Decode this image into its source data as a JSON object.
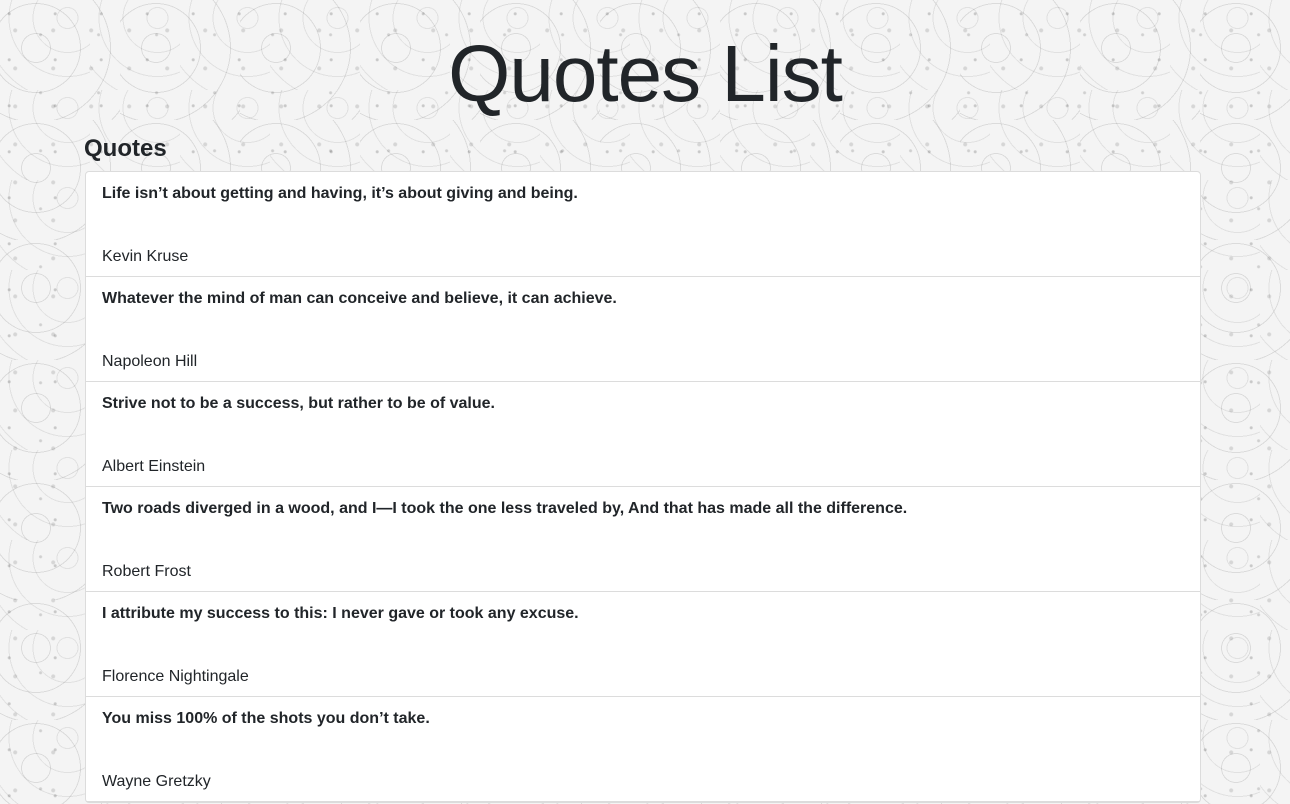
{
  "page": {
    "title": "Quotes List",
    "section_heading": "Quotes"
  },
  "quotes": [
    {
      "text": "Life isn’t about getting and having, it’s about giving and being.",
      "author": "Kevin Kruse"
    },
    {
      "text": "Whatever the mind of man can conceive and believe, it can achieve.",
      "author": "Napoleon Hill"
    },
    {
      "text": "Strive not to be a success, but rather to be of value.",
      "author": "Albert Einstein"
    },
    {
      "text": "Two roads diverged in a wood, and I—I took the one less traveled by, And that has made all the difference.",
      "author": "Robert Frost"
    },
    {
      "text": "I attribute my success to this: I never gave or took any excuse.",
      "author": "Florence Nightingale"
    },
    {
      "text": "You miss 100% of the shots you don’t take.",
      "author": "Wayne Gretzky"
    }
  ]
}
